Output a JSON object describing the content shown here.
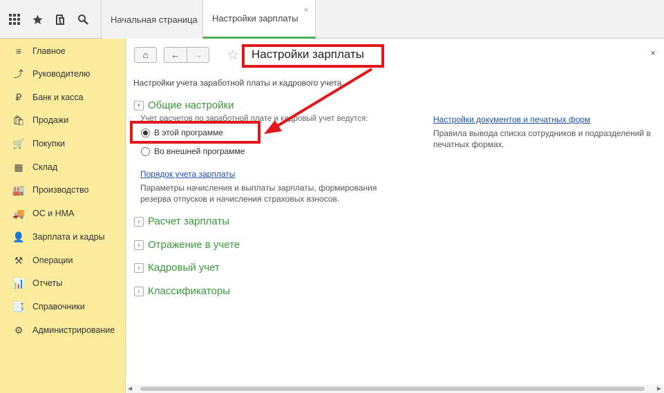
{
  "topbar": {
    "icons": [
      "apps-grid-icon",
      "star-icon",
      "history-icon",
      "search-icon"
    ],
    "tabs": [
      {
        "label": "Начальная страница"
      },
      {
        "label": "Настройки зарплаты",
        "close": "×"
      }
    ]
  },
  "sidebar": {
    "items": [
      {
        "label": "Главное",
        "icon": "≡"
      },
      {
        "label": "Руководителю",
        "icon": "⤴"
      },
      {
        "label": "Банк и касса",
        "icon": "₽"
      },
      {
        "label": "Продажи",
        "icon": "🛍"
      },
      {
        "label": "Покупки",
        "icon": "🛒"
      },
      {
        "label": "Склад",
        "icon": "▦"
      },
      {
        "label": "Производство",
        "icon": "🏭"
      },
      {
        "label": "ОС и НМА",
        "icon": "🚚"
      },
      {
        "label": "Зарплата и кадры",
        "icon": "👤"
      },
      {
        "label": "Операции",
        "icon": "⚒"
      },
      {
        "label": "Отчеты",
        "icon": "📊"
      },
      {
        "label": "Справочники",
        "icon": "📑"
      },
      {
        "label": "Администрирование",
        "icon": "⚙"
      }
    ]
  },
  "content": {
    "nav": {
      "home": "⌂",
      "back": "←",
      "forward": "→"
    },
    "star": "☆",
    "title": "Настройки зарплаты",
    "close": "×",
    "intro": "Настройки учета заработной платы и кадрового учета.",
    "general": {
      "toggle": "˅",
      "label": "Общие настройки",
      "note": "Учет расчетов по заработной плате и кадровый учет ведутся:",
      "options": [
        "В этой программе",
        "Во внешней программе"
      ],
      "selected": 0,
      "order_link": "Порядок учета зарплаты",
      "order_desc": "Параметры начисления и выплаты зарплаты, формирования резерва отпусков и начисления страховых взносов.",
      "docs_link": "Настройки документов и печатных форм",
      "docs_desc": "Правила вывода списка сотрудников и подразделений в печатных формах."
    },
    "groups": [
      {
        "toggle": "›",
        "label": "Расчет зарплаты"
      },
      {
        "toggle": "›",
        "label": "Отражение в учете"
      },
      {
        "toggle": "›",
        "label": "Кадровый учет"
      },
      {
        "toggle": "›",
        "label": "Классификаторы"
      }
    ],
    "scroll": {
      "left": "◀",
      "right": "▶"
    }
  },
  "colors": {
    "accent_green": "#3a9a3a",
    "highlight_red": "#e3161b",
    "sidebar_bg": "#fbec9d",
    "link_blue": "#2250a8"
  }
}
